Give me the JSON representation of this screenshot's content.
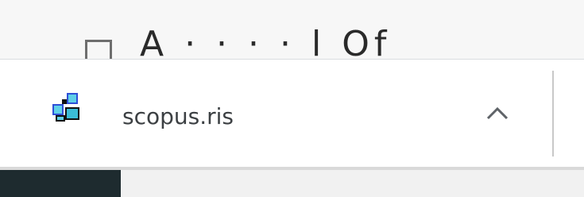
{
  "background_page": {
    "partial_text": "A  ·  ·  ·  ·  l Of"
  },
  "download_shelf": {
    "item": {
      "file_name": "scopus.ris",
      "icon": "reference-file-icon",
      "menu_icon": "chevron-up-icon"
    }
  },
  "colors": {
    "shelf_background": "#ffffff",
    "text": "#3c4043",
    "divider": "#c8c8c8",
    "taskbar_dark": "#1e2b2f"
  }
}
